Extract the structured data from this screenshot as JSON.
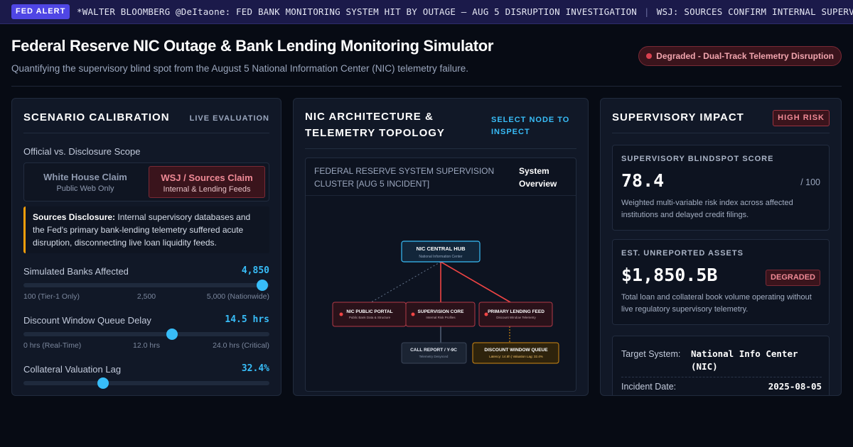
{
  "ticker": {
    "badge": "FED ALERT",
    "items": [
      "*WALTER BLOOMBERG @DeItaone: FED BANK MONITORING SYSTEM HIT BY OUTAGE — AUG 5 DISRUPTION INVESTIGATION",
      "WSJ: SOURCES CONFIRM INTERNAL SUPERVISORY DATABASES AFFECTED"
    ],
    "separator": "|"
  },
  "header": {
    "title": "Federal Reserve NIC Outage & Bank Lending Monitoring Simulator",
    "subtitle": "Quantifying the supervisory blind spot from the August 5 National Information Center (NIC) telemetry failure.",
    "status": "Degraded - Dual-Track Telemetry Disruption"
  },
  "calibration": {
    "title": "SCENARIO CALIBRATION",
    "tag": "LIVE EVALUATION",
    "scope_label": "Official vs. Disclosure Scope",
    "options": [
      {
        "title": "White House Claim",
        "sub": "Public Web Only"
      },
      {
        "title": "WSJ / Sources Claim",
        "sub": "Internal & Lending Feeds"
      }
    ],
    "disclosure_title": "Sources Disclosure:",
    "disclosure_text": "Internal supervisory databases and the Fed's primary bank-lending telemetry suffered acute disruption, disconnecting live loan liquidity feeds.",
    "sliders": [
      {
        "label": "Simulated Banks Affected",
        "value": "4,850",
        "fraction": 0.97,
        "ticks": [
          "100 (Tier-1 Only)",
          "2,500",
          "5,000 (Nationwide)"
        ]
      },
      {
        "label": "Discount Window Queue Delay",
        "value": "14.5 hrs",
        "fraction": 0.604,
        "ticks": [
          "0 hrs (Real-Time)",
          "12.0 hrs",
          "24.0 hrs (Critical)"
        ]
      },
      {
        "label": "Collateral Valuation Lag",
        "value": "32.4%",
        "fraction": 0.324,
        "ticks": [
          "",
          "",
          ""
        ]
      }
    ]
  },
  "topology": {
    "title": "NIC ARCHITECTURE & TELEMETRY TOPOLOGY",
    "select_hint": "SELECT NODE TO INSPECT",
    "cluster": "FEDERAL RESERVE SYSTEM SUPERVISION CLUSTER [AUG 5 INCIDENT]",
    "view": "System Overview",
    "nodes": {
      "hub": {
        "title": "NIC CENTRAL HUB",
        "sub": "National Information Center"
      },
      "portal": {
        "title": "NIC PUBLIC PORTAL",
        "sub": "Public Bank Data & Structure"
      },
      "core": {
        "title": "SUPERVISION CORE",
        "sub": "Internal Risk Profiles"
      },
      "lending": {
        "title": "PRIMARY LENDING FEED",
        "sub": "Discount Window Telemetry"
      },
      "callreport": {
        "title": "CALL REPORT / Y-9C",
        "sub": "Telemetry Desynced"
      },
      "queue": {
        "title": "DISCOUNT WINDOW QUEUE",
        "sub": "Latency: 14.5h | Valuation Lag: 32.4%"
      }
    },
    "colors": {
      "hub": "#38bdf8",
      "alert": "#ef4444",
      "warn": "#f59e0b",
      "muted": "#64748b"
    }
  },
  "impact": {
    "title": "SUPERVISORY IMPACT",
    "badge": "HIGH RISK",
    "blindspot": {
      "label": "SUPERVISORY BLINDSPOT SCORE",
      "value": "78.4",
      "suffix": "/ 100",
      "desc": "Weighted multi-variable risk index across affected institutions and delayed credit filings."
    },
    "assets": {
      "label": "EST. UNREPORTED ASSETS",
      "value": "$1,850.5B",
      "badge": "DEGRADED",
      "desc": "Total loan and collateral book volume operating without live regulatory supervisory telemetry."
    },
    "details": [
      {
        "key": "Target System:",
        "value": "National Info Center (NIC)"
      },
      {
        "key": "Incident Date:",
        "value": "2025-08-05"
      }
    ]
  }
}
